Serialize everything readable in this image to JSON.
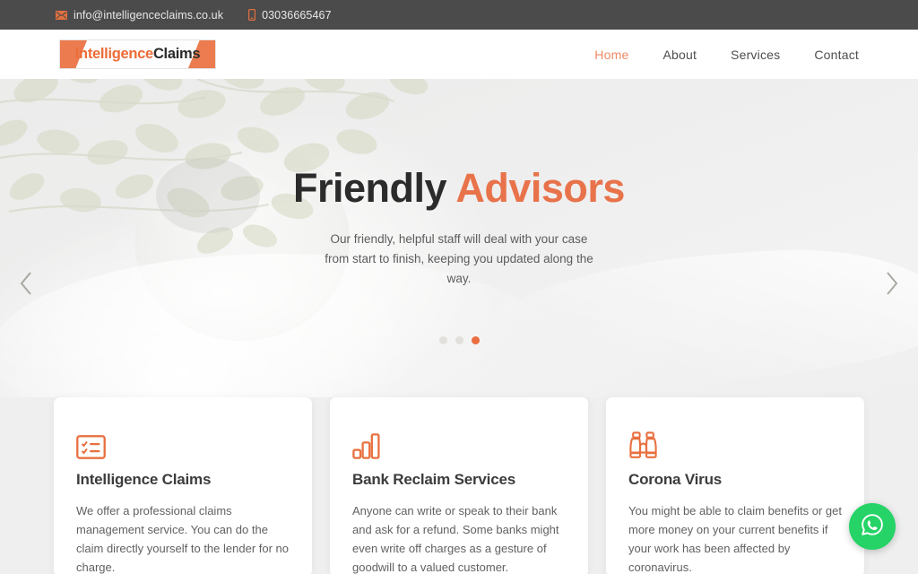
{
  "topbar": {
    "email": "info@intelligenceclaims.co.uk",
    "phone": "03036665467",
    "email_icon": "envelope-icon",
    "phone_icon": "mobile-phone-icon",
    "background_color": "#4b4b4b"
  },
  "header": {
    "logo": {
      "word1": "Intelligence",
      "word2": "Claims",
      "accent_color": "#ec6c37"
    },
    "nav": [
      {
        "label": "Home",
        "active": true
      },
      {
        "label": "About",
        "active": false
      },
      {
        "label": "Services",
        "active": false
      },
      {
        "label": "Contact",
        "active": false
      }
    ],
    "active_color": "#ef8a63"
  },
  "hero": {
    "title_plain": "Friendly ",
    "title_accent": "Advisors",
    "subtitle": "Our friendly, helpful staff will deal with your case from start to finish, keeping you updated along the way.",
    "accent_color": "#e8734b",
    "prev_label": "Previous slide",
    "next_label": "Next slide",
    "dots": [
      {
        "active": false
      },
      {
        "active": false
      },
      {
        "active": true
      }
    ],
    "active_dot_color": "#ea6e3f"
  },
  "cards": [
    {
      "icon": "checklist-icon",
      "title": "Intelligence Claims",
      "body": "We offer a professional claims management service. You can do the claim directly yourself to the lender for no charge."
    },
    {
      "icon": "bar-chart-icon",
      "title": "Bank Reclaim Services",
      "body": "Anyone can write or speak to their bank and ask for a refund. Some banks might even write off charges as a gesture of goodwill to a valued customer."
    },
    {
      "icon": "binoculars-icon",
      "title": "Corona Virus",
      "body": "You might be able to claim benefits or get more money on your current benefits if your work has been affected by coronavirus."
    }
  ],
  "whatsapp": {
    "icon": "whatsapp-icon",
    "label": "Chat on WhatsApp",
    "color": "#25d366"
  }
}
